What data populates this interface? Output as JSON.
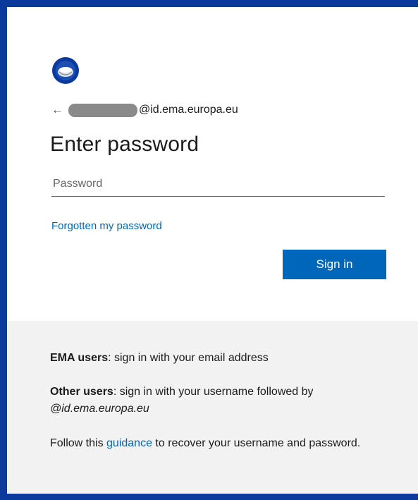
{
  "header": {
    "logo_icon": "ema-logo-icon",
    "back_icon": "arrow-left-icon",
    "email_domain": "@id.ema.europa.eu"
  },
  "form": {
    "title": "Enter password",
    "password_placeholder": "Password",
    "password_value": "",
    "forgot_link": "Forgotten my password",
    "signin_label": "Sign in"
  },
  "info": {
    "ema_users_bold": "EMA users",
    "ema_users_text": ": sign in with your email address",
    "other_users_bold": "Other users",
    "other_users_text": ": sign in with your username followed by",
    "other_users_domain": "@id.ema.europa.eu",
    "follow_text_1": "Follow this ",
    "guidance_link": "guidance",
    "follow_text_2": " to recover your username and password."
  },
  "colors": {
    "accent": "#0067b8",
    "border": "#0b3a9c",
    "info_bg": "#f2f2f2"
  }
}
